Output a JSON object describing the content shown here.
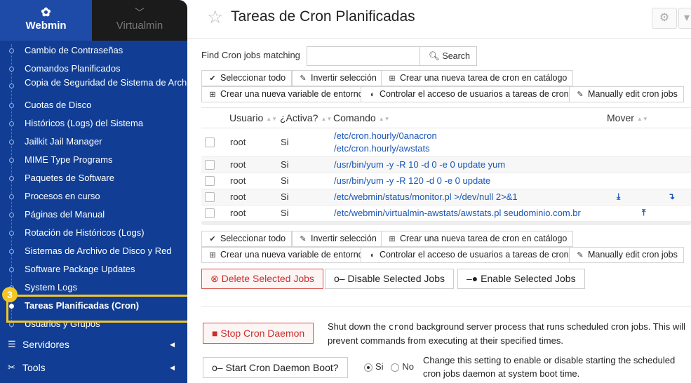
{
  "sidebar": {
    "brand": {
      "label": "Webmin",
      "alt_label": "Virtualmin"
    },
    "items": [
      {
        "label": "Cambio de Contraseñas"
      },
      {
        "label": "Comandos Planificados"
      },
      {
        "label": "Copia de Seguridad de Sistema de Archivos"
      },
      {
        "label": "Cuotas de Disco"
      },
      {
        "label": "Históricos (Logs) del Sistema"
      },
      {
        "label": "Jailkit Jail Manager"
      },
      {
        "label": "MIME Type Programs"
      },
      {
        "label": "Paquetes de Software"
      },
      {
        "label": "Procesos en curso"
      },
      {
        "label": "Páginas del Manual"
      },
      {
        "label": "Rotación de Históricos (Logs)"
      },
      {
        "label": "Sistemas de Archivo de Disco y Red"
      },
      {
        "label": "Software Package Updates"
      },
      {
        "label": "System Logs"
      },
      {
        "label": "Tareas Planificadas (Cron)"
      },
      {
        "label": "Usuarios y Grupos"
      }
    ],
    "sections": [
      {
        "label": "Servidores"
      },
      {
        "label": "Tools"
      }
    ],
    "highlight_badge": "3"
  },
  "page": {
    "title": "Tareas de Cron Planificadas"
  },
  "search": {
    "label": "Find Cron jobs matching",
    "value": "",
    "button": "Search"
  },
  "actions": {
    "select_all": "Seleccionar todo",
    "invert": "Invertir selección",
    "create_job": "Crear una nueva tarea de cron en catálogo",
    "create_var": "Crear una nueva variable de entorno",
    "control_access": "Controlar el acceso de usuarios a tareas de cron",
    "manual_edit": "Manually edit cron jobs"
  },
  "table": {
    "headers": {
      "user": "Usuario",
      "active": "¿Activa?",
      "command": "Comando",
      "move": "Mover"
    },
    "rows": [
      {
        "user": "root",
        "active": "Si",
        "command": "/etc/cron.hourly/0anacron",
        "command2": "/etc/cron.hourly/awstats"
      },
      {
        "user": "root",
        "active": "Si",
        "command": "/usr/bin/yum -y -R 10 -d 0 -e 0 update yum"
      },
      {
        "user": "root",
        "active": "Si",
        "command": "/usr/bin/yum -y -R 120 -d 0 -e 0 update"
      },
      {
        "user": "root",
        "active": "Si",
        "command": "/etc/webmin/status/monitor.pl >/dev/null 2>&1"
      },
      {
        "user": "root",
        "active": "Si",
        "command": "/etc/webmin/virtualmin-awstats/awstats.pl seudominio.com.br"
      }
    ]
  },
  "job_buttons": {
    "delete": "Delete Selected Jobs",
    "disable": "Disable Selected Jobs",
    "enable": "Enable Selected Jobs"
  },
  "daemon": {
    "stop_label": "Stop Cron Daemon",
    "stop_desc_a": "Shut down the",
    "stop_desc_code": "crond",
    "stop_desc_b": "background server process that runs scheduled cron jobs. This will prevent commands from executing at their specified times.",
    "boot_label": "Start Cron Daemon Boot?",
    "boot_yes": "Si",
    "boot_no": "No",
    "boot_desc": "Change this setting to enable or disable starting the scheduled cron jobs daemon at system boot time."
  },
  "colors": {
    "sidebar": "#113e94",
    "accent": "#1a56b8",
    "danger": "#c9302c",
    "highlight": "#f3c623"
  }
}
